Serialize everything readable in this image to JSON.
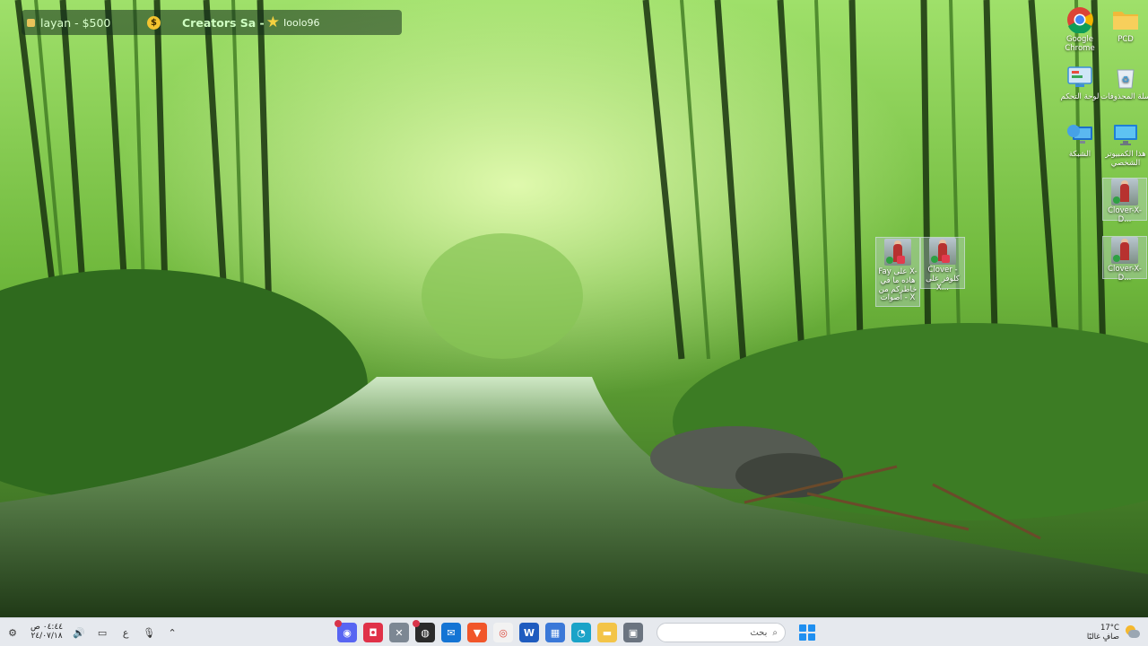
{
  "overlay": {
    "user_label": "layan - $500",
    "coin_symbol": "$",
    "creators_label": "Creators Sa -",
    "handle": "Ioolo96"
  },
  "desktop_icons": [
    {
      "id": "chrome",
      "label": "Google Chrome",
      "icon": "chrome-icon"
    },
    {
      "id": "pcd",
      "label": "PCD",
      "icon": "folder-icon"
    },
    {
      "id": "control-panel",
      "label": "لوحة التحكم",
      "icon": "control-panel-icon"
    },
    {
      "id": "recycle-bin",
      "label": "سلة المحذوفات",
      "icon": "recycle-bin-icon"
    },
    {
      "id": "network",
      "label": "الشبكة",
      "icon": "network-icon"
    },
    {
      "id": "this-pc",
      "label": "هذا الكمبيوتر الشخصي",
      "icon": "monitor-icon"
    },
    {
      "id": "clover-1",
      "label": "Clover-X-D...",
      "icon": "video-thumbnail-icon"
    },
    {
      "id": "clover-2",
      "label": "Clover-X-D...",
      "icon": "video-thumbnail-icon"
    },
    {
      "id": "fay",
      "label": "Fay على X- هاذه ما في خاطركم من اصوات - X",
      "icon": "video-thumbnail-icon"
    },
    {
      "id": "clover-3",
      "label": "Clover - كلوفر على X...",
      "icon": "video-thumbnail-icon"
    }
  ],
  "taskbar": {
    "clock_time": "٠٤:٤٤ ص",
    "clock_date": "٢٤/٠٧/١٨",
    "input_language": "ع",
    "search_placeholder": "بحث",
    "weather_temp": "17°C",
    "weather_desc": "صافٍ غالبًا",
    "apps": [
      {
        "name": "discord-icon",
        "color": "#5865f2",
        "glyph": "◉",
        "badge": true
      },
      {
        "name": "app-red-icon",
        "color": "#e03148",
        "glyph": "◘",
        "badge": false
      },
      {
        "name": "capture-icon",
        "color": "#7c8793",
        "glyph": "✕",
        "badge": false
      },
      {
        "name": "obs-icon",
        "color": "#2b2b2b",
        "glyph": "◍",
        "badge": true
      },
      {
        "name": "mail-icon",
        "color": "#1474d4",
        "glyph": "✉",
        "badge": false
      },
      {
        "name": "brave-icon",
        "color": "#f1562a",
        "glyph": "▼",
        "badge": false
      },
      {
        "name": "chrome-icon",
        "color": "#f2f2f2",
        "glyph": "◎",
        "badge": false
      },
      {
        "name": "word-icon",
        "color": "#1e5bbf",
        "glyph": "W",
        "badge": false
      },
      {
        "name": "store-icon",
        "color": "#3a78d8",
        "glyph": "▦",
        "badge": false
      },
      {
        "name": "edge-icon",
        "color": "#1aa3c8",
        "glyph": "◔",
        "badge": false
      },
      {
        "name": "file-explorer-icon",
        "color": "#f3c448",
        "glyph": "▬",
        "badge": false
      },
      {
        "name": "window-app-icon",
        "color": "#6b7480",
        "glyph": "▣",
        "badge": false
      }
    ]
  }
}
